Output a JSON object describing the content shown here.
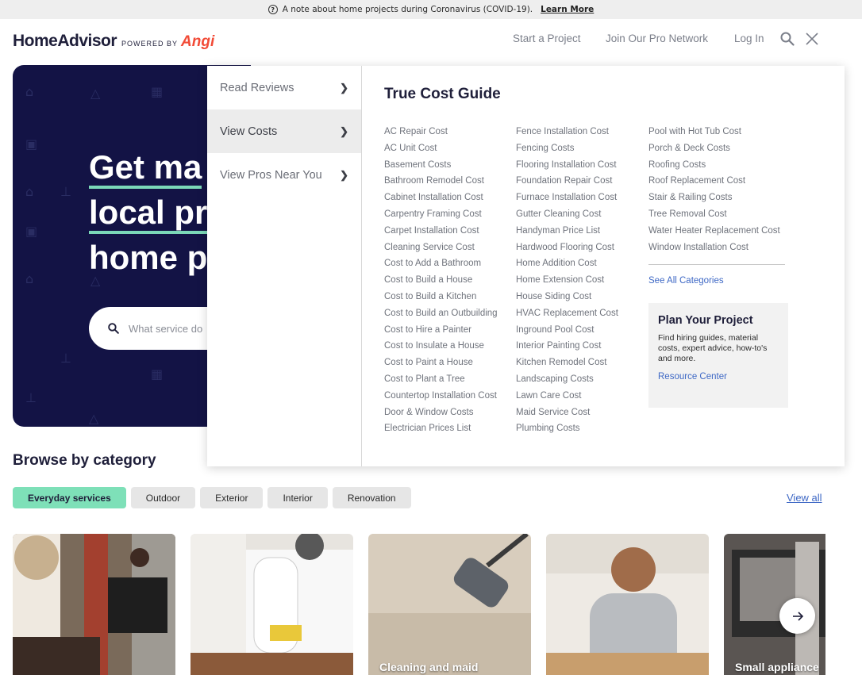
{
  "notice": {
    "text": "A note about home projects during Coronavirus (COVID-19).",
    "link": "Learn More"
  },
  "header": {
    "brand": "HomeAdvisor",
    "powered_by": "POWERED BY",
    "angi": "Angi",
    "nav": [
      "Start a Project",
      "Join Our Pro Network",
      "Log In"
    ]
  },
  "hero": {
    "title_lines": [
      "Get ma",
      "local pr",
      "home p"
    ],
    "search_placeholder": "What service do"
  },
  "dropdown": {
    "menu": [
      {
        "label": "Read Reviews",
        "active": false
      },
      {
        "label": "View Costs",
        "active": true
      },
      {
        "label": "View Pros Near You",
        "active": false
      }
    ],
    "title": "True Cost Guide",
    "col1": [
      "AC Repair Cost",
      "AC Unit Cost",
      "Basement Costs",
      "Bathroom Remodel Cost",
      "Cabinet Installation Cost",
      "Carpentry Framing Cost",
      "Carpet Installation Cost",
      "Cleaning Service Cost",
      "Cost to Add a Bathroom",
      "Cost to Build a House",
      "Cost to Build a Kitchen",
      "Cost to Build an Outbuilding",
      "Cost to Hire a Painter",
      "Cost to Insulate a House",
      "Cost to Paint a House",
      "Cost to Plant a Tree",
      "Countertop Installation Cost",
      "Door & Window Costs",
      "Electrician Prices List"
    ],
    "col2": [
      "Fence Installation Cost",
      "Fencing Costs",
      "Flooring Installation Cost",
      "Foundation Repair Cost",
      "Furnace Installation Cost",
      "Gutter Cleaning Cost",
      "Handyman Price List",
      "Hardwood Flooring Cost",
      "Home Addition Cost",
      "Home Extension Cost",
      "House Siding Cost",
      "HVAC Replacement Cost",
      "Inground Pool Cost",
      "Interior Painting Cost",
      "Kitchen Remodel Cost",
      "Landscaping Costs",
      "Lawn Care Cost",
      "Maid Service Cost",
      "Plumbing Costs"
    ],
    "col3": [
      "Pool with Hot Tub Cost",
      "Porch & Deck Costs",
      "Roofing Costs",
      "Roof Replacement Cost",
      "Stair & Railing Costs",
      "Tree Removal Cost",
      "Water Heater Replacement Cost",
      "Window Installation Cost"
    ],
    "see_all": "See All Categories",
    "plan": {
      "title": "Plan Your Project",
      "desc": "Find hiring guides, material costs, expert advice, how-to's and more.",
      "link": "Resource Center"
    }
  },
  "browse": {
    "title": "Browse by category",
    "chips": [
      {
        "label": "Everyday services",
        "active": true
      },
      {
        "label": "Outdoor",
        "active": false
      },
      {
        "label": "Exterior",
        "active": false
      },
      {
        "label": "Interior",
        "active": false
      },
      {
        "label": "Renovation",
        "active": false
      }
    ],
    "view_all": "View all",
    "cards": [
      {
        "label": "",
        "color": "#6b5a4c"
      },
      {
        "label": "",
        "color": "#d9d6d1"
      },
      {
        "label": "Cleaning and maid",
        "color": "#cbbfae"
      },
      {
        "label": "",
        "color": "#d8d2c8"
      },
      {
        "label": "Small appliance",
        "color": "#5a5552"
      }
    ]
  },
  "colors": {
    "navy": "#131345",
    "accent_green": "#7ee0b8",
    "link_blue": "#3e68c5",
    "angi_red": "#f24b37"
  }
}
